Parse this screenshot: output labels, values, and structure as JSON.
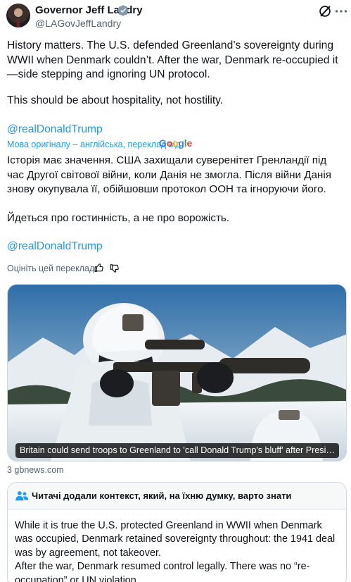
{
  "author": {
    "name": "Governor Jeff Landry",
    "handle": "@LAGovJeffLandry",
    "verified_color": "#829aab"
  },
  "header_icons": {
    "grok": "grok-icon",
    "more": "more-options-icon"
  },
  "post": {
    "text_1": "History matters. The U.S. defended Greenland’s sovereignty during WWII when Denmark couldn’t. After the war, Denmark re-occupied it—side stepping and ignoring UN protocol.",
    "text_2": "This should be about hospitality, not hostility.",
    "mention": "@realDonaldTrump"
  },
  "translation": {
    "label": "Мова оригіналу – англійська, переклад від",
    "provider": "Google",
    "text_1": "Історія має значення. США захищали суверенітет Гренландії під час Другої світової війни, коли Данія не змогла. Після війни Данія знову окупувала її, обійшовши протокол ООН та ігноруючи його.",
    "text_2": "Йдеться про гостинність, а не про ворожість.",
    "mention": "@realDonaldTrump",
    "rate_label": "Оцініть цей переклад:"
  },
  "link_card": {
    "caption": "Britain could send troops to Greenland to 'call Donald Trump's bluff' after President's threats",
    "source": "3 gbnews.com"
  },
  "community_note": {
    "title": "Читачі додали контекст, який, на їхню думку, варто знати",
    "body_1": "While it is true the U.S. protected Greenland in WWII when Denmark was occupied, Denmark retained sovereignty throughout: the 1941 deal was by agreement, not takeover.",
    "body_2": "After the war, Denmark resumed control legally. There was no “re-occupation” or UN violation."
  },
  "colors": {
    "link": "#1d9bf0",
    "secondary_text": "#536471",
    "border": "#cfd9de"
  }
}
